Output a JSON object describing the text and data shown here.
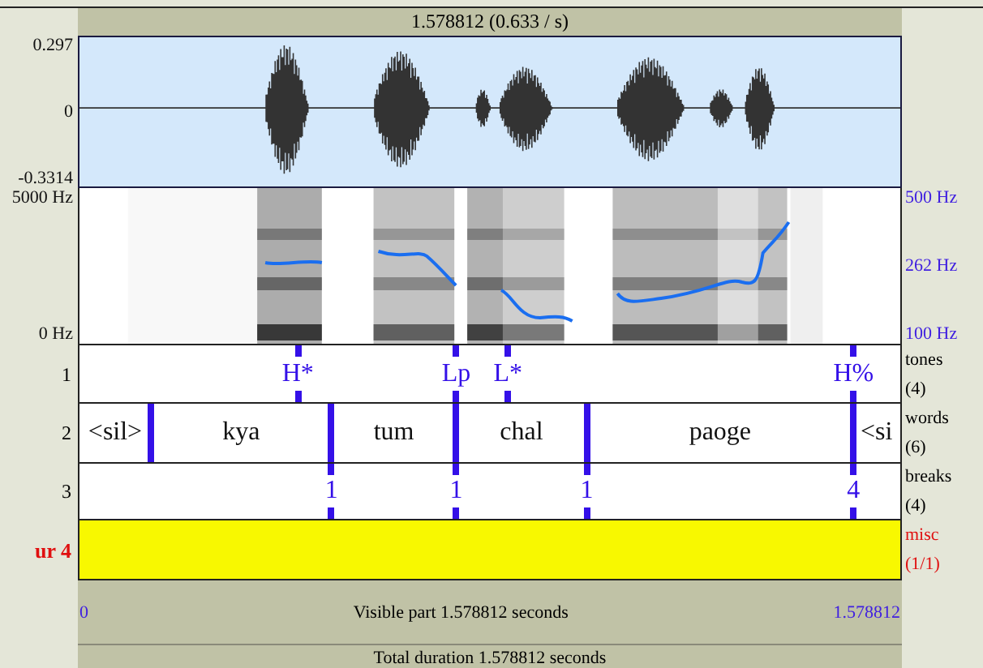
{
  "header": {
    "title": "1.578812 (0.633 / s)"
  },
  "waveform": {
    "max": "0.297",
    "zero": "0",
    "min": "-0.3314"
  },
  "spectrogram": {
    "freq_max": "5000 Hz",
    "freq_min": "0 Hz",
    "pitch_max": "500 Hz",
    "pitch_mid": "262 Hz",
    "pitch_min": "100 Hz"
  },
  "tiers": [
    {
      "number": "1",
      "name": "tones",
      "count": "(4)",
      "kind": "point",
      "selected": false,
      "items": [
        {
          "text": "H*"
        },
        {
          "text": "Lp"
        },
        {
          "text": "L*"
        },
        {
          "text": "H%"
        }
      ]
    },
    {
      "number": "2",
      "name": "words",
      "count": "(6)",
      "kind": "interval",
      "selected": false,
      "items": [
        {
          "text": "<sil>"
        },
        {
          "text": "kya"
        },
        {
          "text": "tum"
        },
        {
          "text": "chal"
        },
        {
          "text": "paoge"
        },
        {
          "text": "<si"
        }
      ]
    },
    {
      "number": "3",
      "name": "breaks",
      "count": "(4)",
      "kind": "point",
      "selected": false,
      "items": [
        {
          "text": "1"
        },
        {
          "text": "1"
        },
        {
          "text": "1"
        },
        {
          "text": "4"
        }
      ]
    },
    {
      "number": "ur 4",
      "name": "misc",
      "count": "(1/1)",
      "kind": "interval",
      "selected": true
    }
  ],
  "visible_bar": {
    "start": "0",
    "label": "Visible part 1.578812 seconds",
    "end": "1.578812"
  },
  "total_bar": {
    "label": "Total duration 1.578812 seconds"
  }
}
